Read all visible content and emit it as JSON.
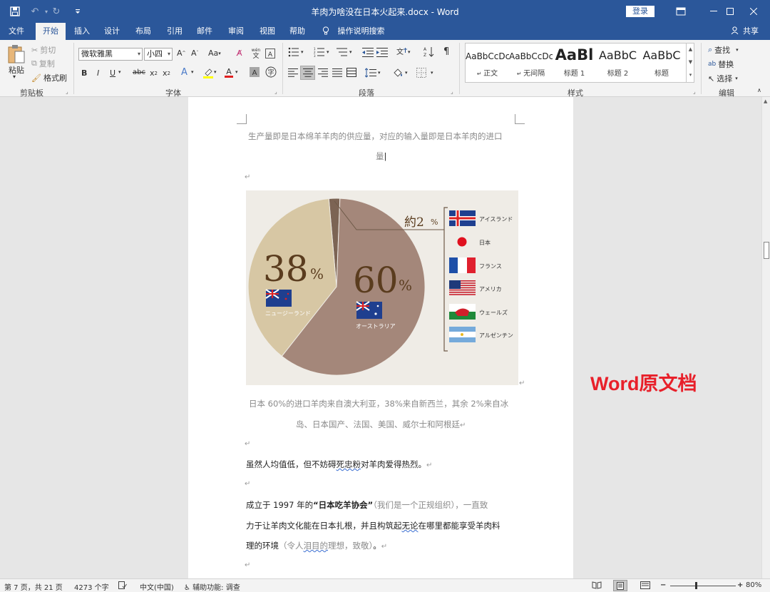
{
  "window": {
    "title": "羊肉为啥没在日本火起来.docx  -  Word",
    "login": "登录",
    "qa_icons": [
      "save-icon",
      "undo-icon",
      "redo-icon",
      "customize-icon"
    ]
  },
  "menu": {
    "tabs": [
      "文件",
      "开始",
      "插入",
      "设计",
      "布局",
      "引用",
      "邮件",
      "审阅",
      "视图",
      "帮助"
    ],
    "active": "开始",
    "tell_me": "操作说明搜索",
    "share": "共享"
  },
  "ribbon": {
    "clipboard": {
      "paste": "粘贴",
      "cut": "剪切",
      "copy": "复制",
      "format_painter": "格式刷",
      "label": "剪贴板"
    },
    "font": {
      "name": "微软雅黑",
      "size": "小四",
      "label": "字体"
    },
    "paragraph": {
      "label": "段落"
    },
    "styles": {
      "label": "样式",
      "items": [
        {
          "sample": "AaBbCcDc",
          "name": "正文"
        },
        {
          "sample": "AaBbCcDc",
          "name": "无间隔"
        },
        {
          "sample": "AaBl",
          "name": "标题 1"
        },
        {
          "sample": "AaBbC",
          "name": "标题 2"
        },
        {
          "sample": "AaBbC",
          "name": "标题"
        }
      ]
    },
    "editing": {
      "find": "查找",
      "replace": "替换",
      "select": "选择",
      "label": "编辑"
    }
  },
  "document": {
    "intro_line1": "生产量即是日本绵羊羊肉的供应量，对应的输入量即是日本羊肉的进口",
    "intro_line2": "量",
    "paragraph_mark": "↵",
    "caption_line1": "日本 60%的进口羊肉来自澳大利亚，38%来自新西兰，其余 2%来自冰",
    "caption_line2": "岛、日本国产、法国、美国、威尔士和阿根廷",
    "body1_a": "虽然人均值低，但不妨碍",
    "body1_b": "死忠粉",
    "body1_c": "对羊肉爱得热烈。",
    "body2_a": "成立于 1997 年的",
    "body2_b": "“日本吃羊协会”",
    "body2_c": "（我们是一个正规组织），一直致",
    "body3_a": "力于让羊肉文化能在日本扎根，并且构筑起",
    "body3_b": "无论",
    "body3_c": "在哪里都能享受羊肉料",
    "body4_a": "理的环境",
    "body4_b": "（令人",
    "body4_c": "泪目的",
    "body4_d": "理想，致敬）",
    "body4_e": "。",
    "overlay_label": "Word原文档"
  },
  "chart_data": {
    "type": "pie",
    "values": [
      60,
      38,
      2
    ],
    "percent_labels": [
      "60",
      "38",
      "約2"
    ],
    "percent_sign": "%",
    "slice_labels": [
      "オーストラリア",
      "ニュージーランド",
      ""
    ],
    "others_legend": [
      "アイスランド",
      "日本",
      "フランス",
      "アメリカ",
      "ウェールズ",
      "アルゼンチン"
    ],
    "colors": [
      "#a4877a",
      "#d7c7a4",
      "#7c6454"
    ]
  },
  "status": {
    "page": "第 7 页，共 21 页",
    "words": "4273 个字",
    "language": "中文(中国)",
    "accessibility": "辅助功能: 调查",
    "zoom": "80%"
  }
}
